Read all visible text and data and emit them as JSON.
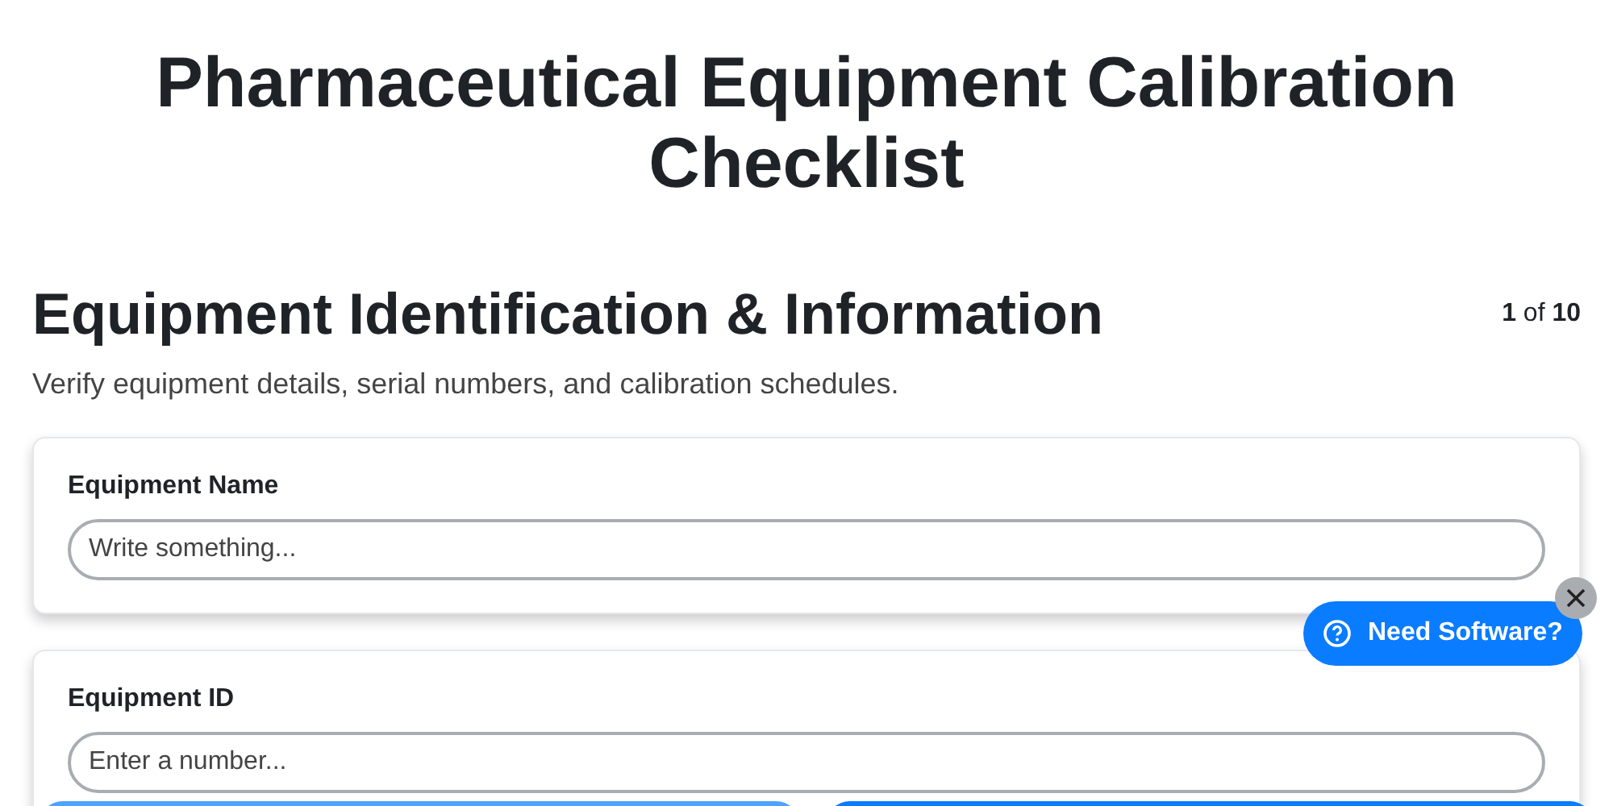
{
  "title": "Pharmaceutical Equipment Calibration Checklist",
  "section": {
    "heading": "Equipment Identification & Information",
    "page_indicator": "**1** of **10**",
    "description": "Verify equipment details, serial numbers, and calibration schedules."
  },
  "fields": [
    {
      "label": "Equipment Name",
      "placeholder": "Write something..."
    },
    {
      "label": "Equipment ID",
      "placeholder": "Enter a number..."
    }
  ],
  "help_button": {
    "label": "Need Software?"
  }
}
